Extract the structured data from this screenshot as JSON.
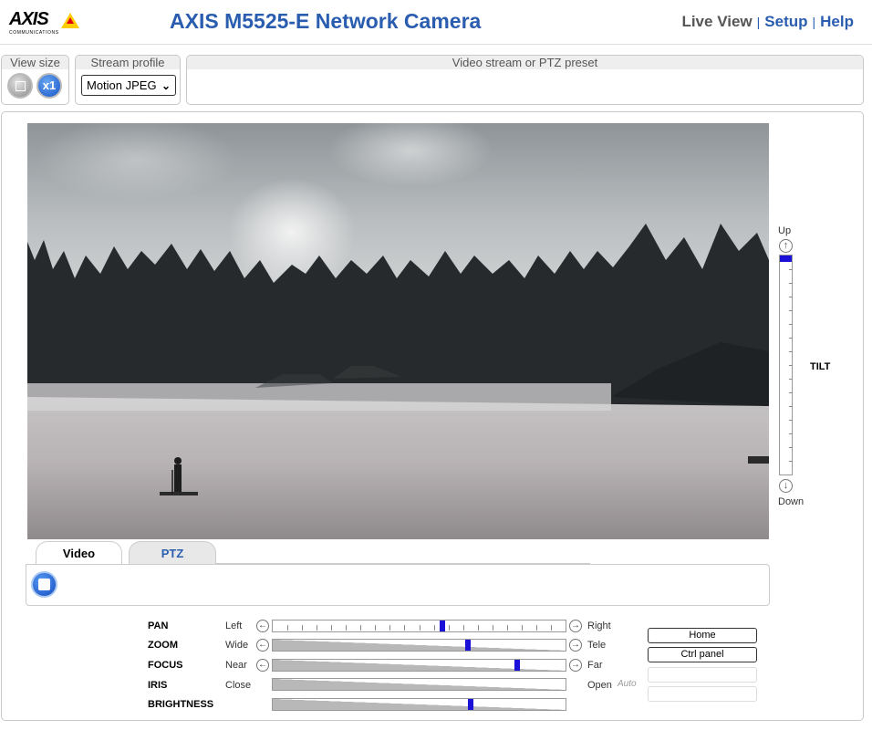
{
  "header": {
    "logo_text": "AXIS",
    "logo_sub": "COMMUNICATIONS",
    "title": "AXIS M5525-E Network Camera",
    "nav": {
      "live": "Live View",
      "setup": "Setup",
      "help": "Help"
    }
  },
  "toolbar": {
    "view_size_label": "View size",
    "stream_profile_label": "Stream profile",
    "stream_profile_value": "Motion JPEG",
    "preset_label": "Video stream or PTZ preset",
    "zoom_button_label": "x1"
  },
  "tilt": {
    "up": "Up",
    "down": "Down",
    "label": "TILT",
    "position": 0.0
  },
  "tabs": {
    "video": "Video",
    "ptz": "PTZ"
  },
  "ptz": {
    "pan": {
      "label": "PAN",
      "min": "Left",
      "max": "Right",
      "position": 0.58
    },
    "zoom": {
      "label": "ZOOM",
      "min": "Wide",
      "max": "Tele",
      "position": 0.67
    },
    "focus": {
      "label": "FOCUS",
      "min": "Near",
      "max": "Far",
      "position": 0.84
    },
    "iris": {
      "label": "IRIS",
      "min": "Close",
      "max": "Open",
      "auto": "Auto"
    },
    "brightness": {
      "label": "BRIGHTNESS",
      "position": 0.68
    }
  },
  "buttons": {
    "home": "Home",
    "ctrl_panel": "Ctrl panel"
  },
  "colors": {
    "accent": "#2a5db0",
    "slider_knob": "#1a10d8"
  }
}
